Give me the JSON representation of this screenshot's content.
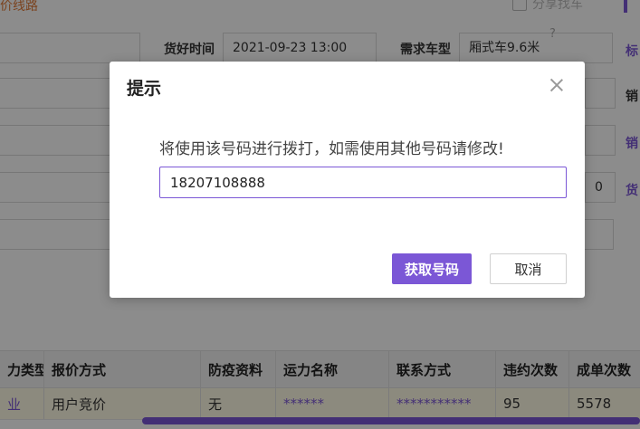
{
  "background": {
    "top_link": "价线路",
    "share_label": "分享找车",
    "fields": {
      "delivery_time_label": "货好时间",
      "delivery_time_value": "2021-09-23 13:00",
      "vehicle_type_label": "需求车型",
      "vehicle_type_value": "厢式车9.6米"
    },
    "right_links": [
      "标",
      "销",
      "销",
      "货"
    ],
    "side_peek_char": "0"
  },
  "table": {
    "columns": [
      "力类型",
      "报价方式",
      "防疫资料",
      "运力名称",
      "联系方式",
      "违约次数",
      "成单次数"
    ],
    "rows": [
      [
        "业",
        "用户竞价",
        "无",
        "******",
        "***********",
        "95",
        "5578"
      ]
    ]
  },
  "modal": {
    "title": "提示",
    "message": "将使用该号码进行拨打，如需使用其他号码请修改!",
    "phone_value": "18207108888",
    "primary_button": "获取号码",
    "cancel_button": "取消"
  },
  "colors": {
    "accent": "#7b57d6",
    "link_orange": "#e07b39",
    "row_highlight": "#fffbe6"
  }
}
